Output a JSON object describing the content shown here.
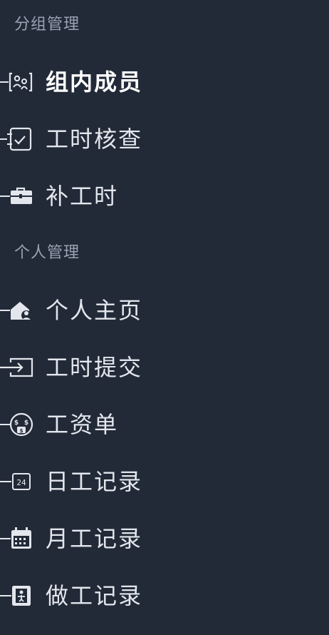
{
  "sections": [
    {
      "title": "分组管理",
      "items": [
        {
          "label": "组内成员",
          "icon": "group-members-icon",
          "active": true
        },
        {
          "label": "工时核查",
          "icon": "checklist-icon",
          "active": false
        },
        {
          "label": "补工时",
          "icon": "toolbox-icon",
          "active": false
        }
      ]
    },
    {
      "title": "个人管理",
      "items": [
        {
          "label": "个人主页",
          "icon": "home-user-icon",
          "active": false
        },
        {
          "label": "工时提交",
          "icon": "submit-login-icon",
          "active": false
        },
        {
          "label": "工资单",
          "icon": "money-face-icon",
          "active": false
        },
        {
          "label": "日工记录",
          "icon": "calendar-24-icon",
          "active": false
        },
        {
          "label": "月工记录",
          "icon": "calendar-month-icon",
          "active": false
        },
        {
          "label": "做工记录",
          "icon": "work-record-icon",
          "active": false
        }
      ]
    }
  ],
  "colors": {
    "background": "#222a38",
    "section_title": "#9aa3b2",
    "label": "#e3e6ec",
    "active_label": "#ffffff",
    "icon": "#e3e6ec"
  }
}
